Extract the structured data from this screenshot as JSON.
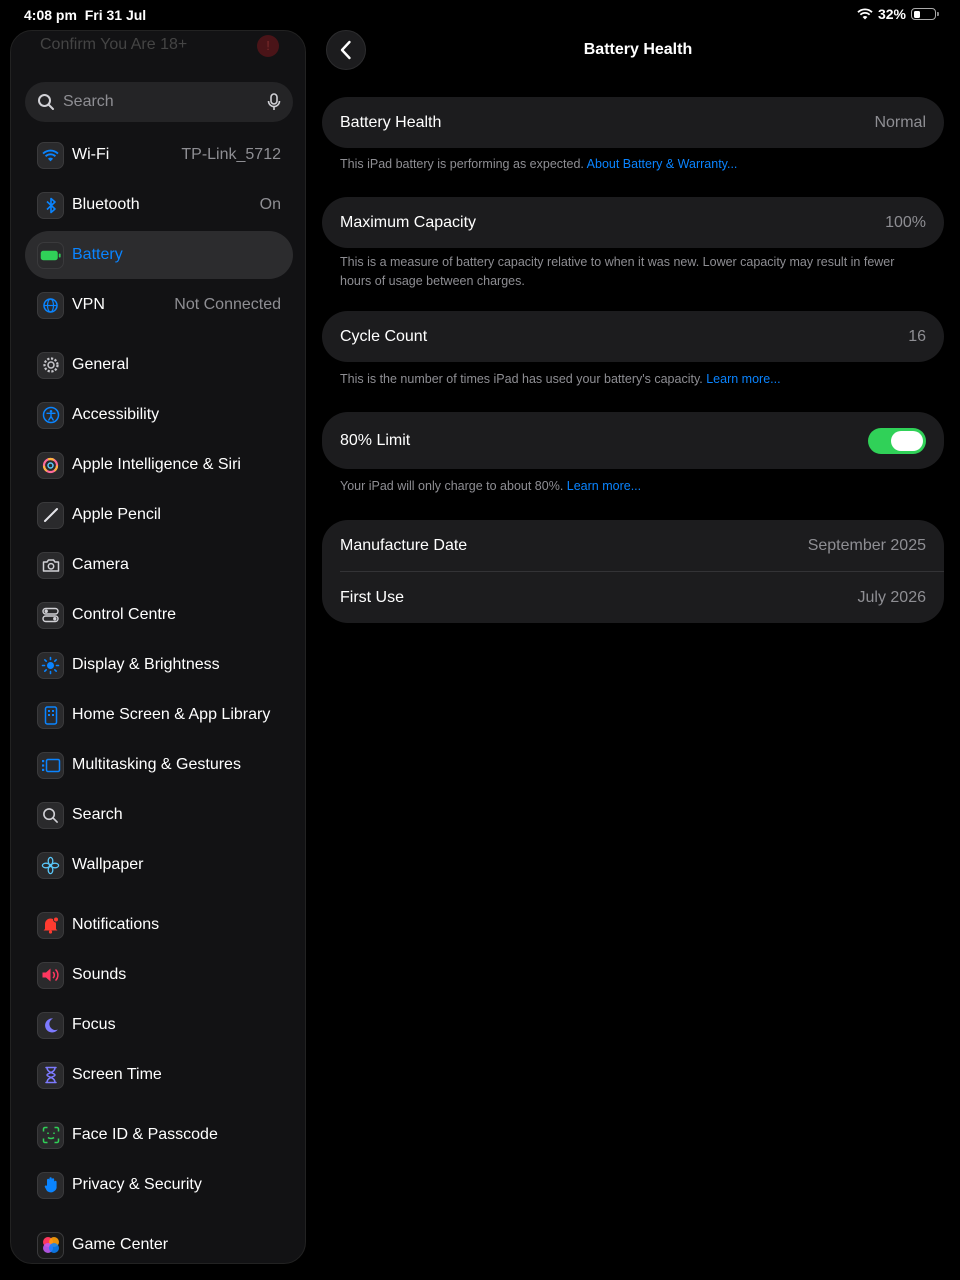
{
  "status_bar": {
    "time": "4:08 pm",
    "date": "Fri 31 Jul",
    "battery_percent": "32%",
    "battery_level": 0.32
  },
  "sidebar": {
    "faded_banner": "Confirm You Are 18+",
    "faded_badge": "!",
    "search_placeholder": "Search",
    "items": [
      {
        "label": "Wi-Fi",
        "value": "TP-Link_5712",
        "icon": "wifi-icon",
        "color": "#0a84ff"
      },
      {
        "label": "Bluetooth",
        "value": "On",
        "icon": "bluetooth-icon",
        "color": "#0a84ff"
      },
      {
        "label": "Battery",
        "value": "",
        "icon": "battery-icon",
        "color": "#30d158",
        "selected": true
      },
      {
        "label": "VPN",
        "value": "Not Connected",
        "icon": "globe-icon",
        "color": "#0a84ff"
      },
      {
        "label": "General",
        "value": "",
        "icon": "gear-icon",
        "color": "#8e8e93"
      },
      {
        "label": "Accessibility",
        "value": "",
        "icon": "accessibility-icon",
        "color": "#0a84ff"
      },
      {
        "label": "Apple Intelligence & Siri",
        "value": "",
        "icon": "siri-icon",
        "color": "#ff6b9a"
      },
      {
        "label": "Apple Pencil",
        "value": "",
        "icon": "pencil-icon",
        "color": "#c7c7cc"
      },
      {
        "label": "Camera",
        "value": "",
        "icon": "camera-icon",
        "color": "#8e8e93"
      },
      {
        "label": "Control Centre",
        "value": "",
        "icon": "toggles-icon",
        "color": "#8e8e93"
      },
      {
        "label": "Display & Brightness",
        "value": "",
        "icon": "sun-icon",
        "color": "#0a84ff"
      },
      {
        "label": "Home Screen & App Library",
        "value": "",
        "icon": "home-screen-icon",
        "color": "#0a84ff"
      },
      {
        "label": "Multitasking & Gestures",
        "value": "",
        "icon": "multitasking-icon",
        "color": "#0a84ff"
      },
      {
        "label": "Search",
        "value": "",
        "icon": "magnifier-icon",
        "color": "#8e8e93"
      },
      {
        "label": "Wallpaper",
        "value": "",
        "icon": "flower-icon",
        "color": "#5ac8fa"
      },
      {
        "label": "Notifications",
        "value": "",
        "icon": "bell-icon",
        "color": "#ff3b30"
      },
      {
        "label": "Sounds",
        "value": "",
        "icon": "speaker-icon",
        "color": "#ff375f"
      },
      {
        "label": "Focus",
        "value": "",
        "icon": "moon-icon",
        "color": "#7d7aff"
      },
      {
        "label": "Screen Time",
        "value": "",
        "icon": "hourglass-icon",
        "color": "#7d7aff"
      },
      {
        "label": "Face ID & Passcode",
        "value": "",
        "icon": "faceid-icon",
        "color": "#30d158"
      },
      {
        "label": "Privacy & Security",
        "value": "",
        "icon": "hand-icon",
        "color": "#0a84ff"
      },
      {
        "label": "Game Center",
        "value": "",
        "icon": "game-center-icon",
        "color": "#ff9f0a"
      }
    ]
  },
  "main": {
    "title": "Battery Health",
    "health": {
      "label": "Battery Health",
      "value": "Normal"
    },
    "health_footer": "This iPad battery is performing as expected. ",
    "health_footer_link": "About Battery & Warranty...",
    "capacity": {
      "label": "Maximum Capacity",
      "value": "100%"
    },
    "capacity_footer": "This is a measure of battery capacity relative to when it was new. Lower capacity may result in fewer hours of usage between charges.",
    "cycle": {
      "label": "Cycle Count",
      "value": "16"
    },
    "cycle_footer": "This is the number of times iPad has used your battery's capacity. ",
    "cycle_footer_link": "Learn more...",
    "limit": {
      "label": "80% Limit",
      "enabled": true
    },
    "limit_footer": "Your iPad will only charge to about 80%. ",
    "limit_footer_link": "Learn more...",
    "manufacture": {
      "label": "Manufacture Date",
      "value": "September 2025"
    },
    "first_use": {
      "label": "First Use",
      "value": "July 2026"
    }
  },
  "colors": {
    "accent": "#0a84ff",
    "toggle_on": "#30d158",
    "card_bg": "#1c1c1e"
  }
}
